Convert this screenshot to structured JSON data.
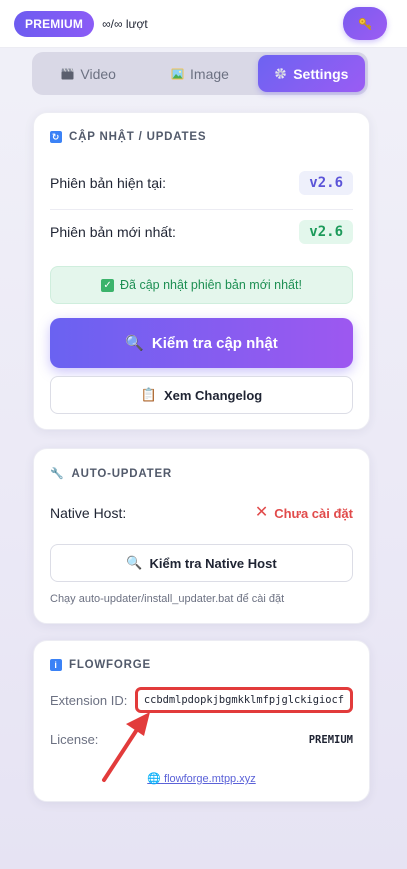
{
  "header": {
    "badge": "PREMIUM",
    "quota": "∞/∞ lượt",
    "key_icon": "key-icon"
  },
  "tabs": [
    {
      "label": "Video",
      "icon": "clapper-icon",
      "active": false
    },
    {
      "label": "Image",
      "icon": "image-icon",
      "active": false
    },
    {
      "label": "Settings",
      "icon": "gear-icon",
      "active": true
    }
  ],
  "updates": {
    "title": "CẬP NHẬT / UPDATES",
    "current_label": "Phiên bản hiện tại:",
    "current_value": "v2.6",
    "latest_label": "Phiên bản mới nhất:",
    "latest_value": "v2.6",
    "status_message": "Đã cập nhật phiên bản mới nhất!",
    "check_button": "Kiểm tra cập nhật",
    "changelog_button": "Xem Changelog"
  },
  "auto_updater": {
    "title": "AUTO-UPDATER",
    "native_host_label": "Native Host:",
    "native_host_status": "Chưa cài đặt",
    "check_button": "Kiểm tra Native Host",
    "hint": "Chạy auto-updater/install_updater.bat để cài đặt"
  },
  "flowforge": {
    "title": "FLOWFORGE",
    "extension_id_label": "Extension ID:",
    "extension_id": "ccbdmlpdopkjbgmkklmfpjglckigiocf",
    "license_label": "License:",
    "license_value": "PREMIUM",
    "link": "flowforge.mtpp.xyz"
  },
  "colors": {
    "accent": "#7c5cf2",
    "success": "#1c9a5a",
    "error": "#e14b4b",
    "highlight": "#e23b3b"
  }
}
